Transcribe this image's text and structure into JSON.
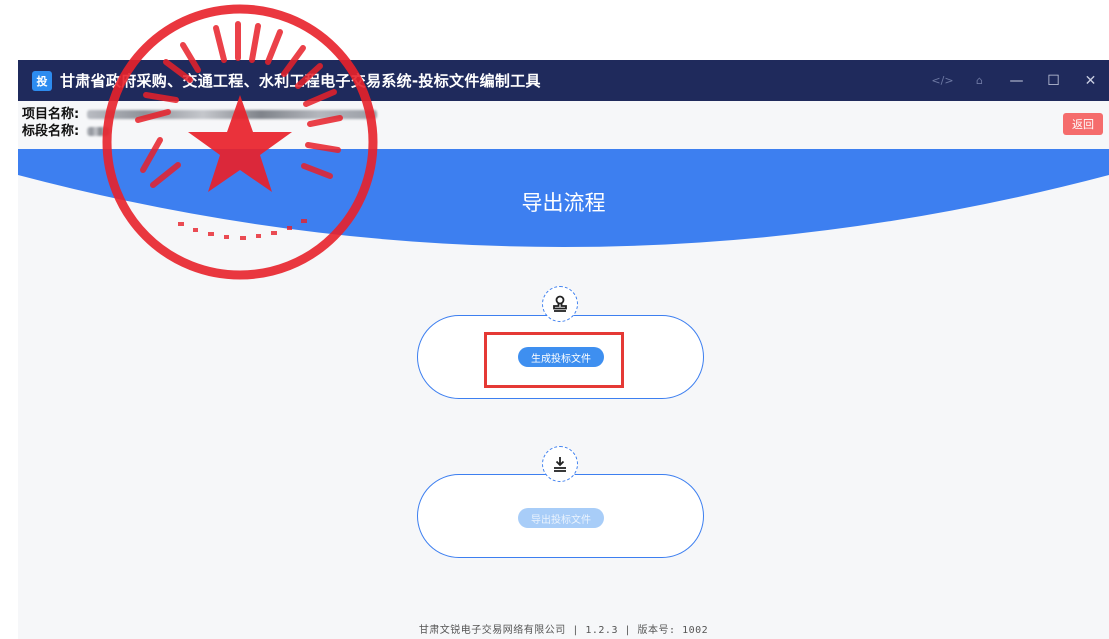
{
  "titlebar": {
    "logo_text": "投",
    "title": "甘肃省政府采购、交通工程、水利工程电子交易系统-投标文件编制工具",
    "controls": [
      {
        "name": "code-icon",
        "glyph": "</>"
      },
      {
        "name": "home-icon",
        "glyph": "⌂"
      },
      {
        "name": "minimize-icon",
        "glyph": "—"
      },
      {
        "name": "maximize-icon",
        "glyph": "☐"
      },
      {
        "name": "close-icon",
        "glyph": "✕"
      }
    ]
  },
  "info": {
    "project_label": "项目名称:",
    "section_label": "标段名称:"
  },
  "actions": {
    "back_label": "返回"
  },
  "banner": {
    "title": "导出流程"
  },
  "steps": [
    {
      "icon": "stamp-icon",
      "button_label": "生成投标文件",
      "state": "enabled"
    },
    {
      "icon": "download-icon",
      "button_label": "导出投标文件",
      "state": "disabled"
    }
  ],
  "footer": {
    "text": "甘肃文锐电子交易网络有限公司 | 1.2.3 | 版本号: 1002"
  },
  "colors": {
    "titlebar_bg": "#1f2a5c",
    "accent_blue": "#3d7ff0",
    "back_button": "#f56c6c",
    "highlight_red": "#e53935",
    "stamp_red": "#e8212a"
  }
}
